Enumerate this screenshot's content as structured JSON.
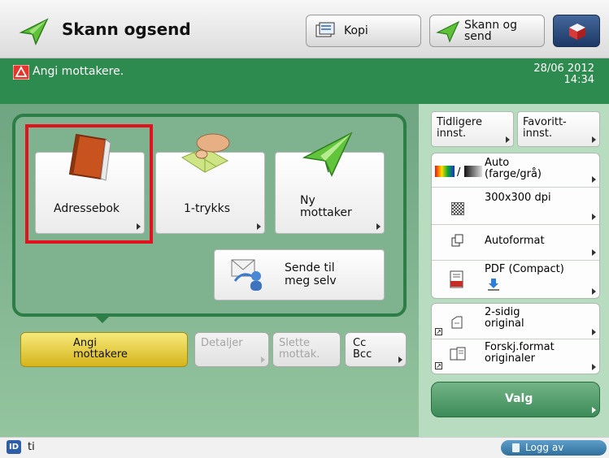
{
  "header": {
    "title": "Skann ogsend",
    "kopi_label": "Kopi",
    "scan_send_label_line1": "Skann og",
    "scan_send_label_line2": "send"
  },
  "status": {
    "message": "Angi mottakere.",
    "date": "28/06 2012",
    "time": "14:34"
  },
  "destination": {
    "address_book": "Adressebok",
    "one_touch": "1-trykks",
    "new_recipient_line1": "Ny",
    "new_recipient_line2": "mottaker",
    "send_to_myself_line1": "Sende til",
    "send_to_myself_line2": "meg selv"
  },
  "actions": {
    "specify_line1": "Angi",
    "specify_line2": "mottakere",
    "details": "Detaljer",
    "delete_line1": "Slette",
    "delete_line2": "mottak.",
    "cc": "Cc",
    "bcc": "Bcc"
  },
  "right_panel": {
    "previous_line1": "Tidligere",
    "previous_line2": "innst.",
    "favorite_line1": "Favoritt-",
    "favorite_line2": "innst.",
    "color_line1": "Auto",
    "color_line2": "(farge/grå)",
    "resolution": "300x300 dpi",
    "format": "Autoformat",
    "file_type": "PDF (Compact)",
    "duplex_line1": "2-sidig",
    "duplex_line2": "original",
    "mixed_line1": "Forskj.format",
    "mixed_line2": "originaler",
    "options": "Valg"
  },
  "bottom": {
    "user": "ti",
    "id_badge": "ID",
    "logout": "Logg av"
  },
  "colors": {
    "status_green": "#2e8b4f",
    "highlight_red": "#e2121e",
    "selected_yellow": "#e5c83a"
  }
}
